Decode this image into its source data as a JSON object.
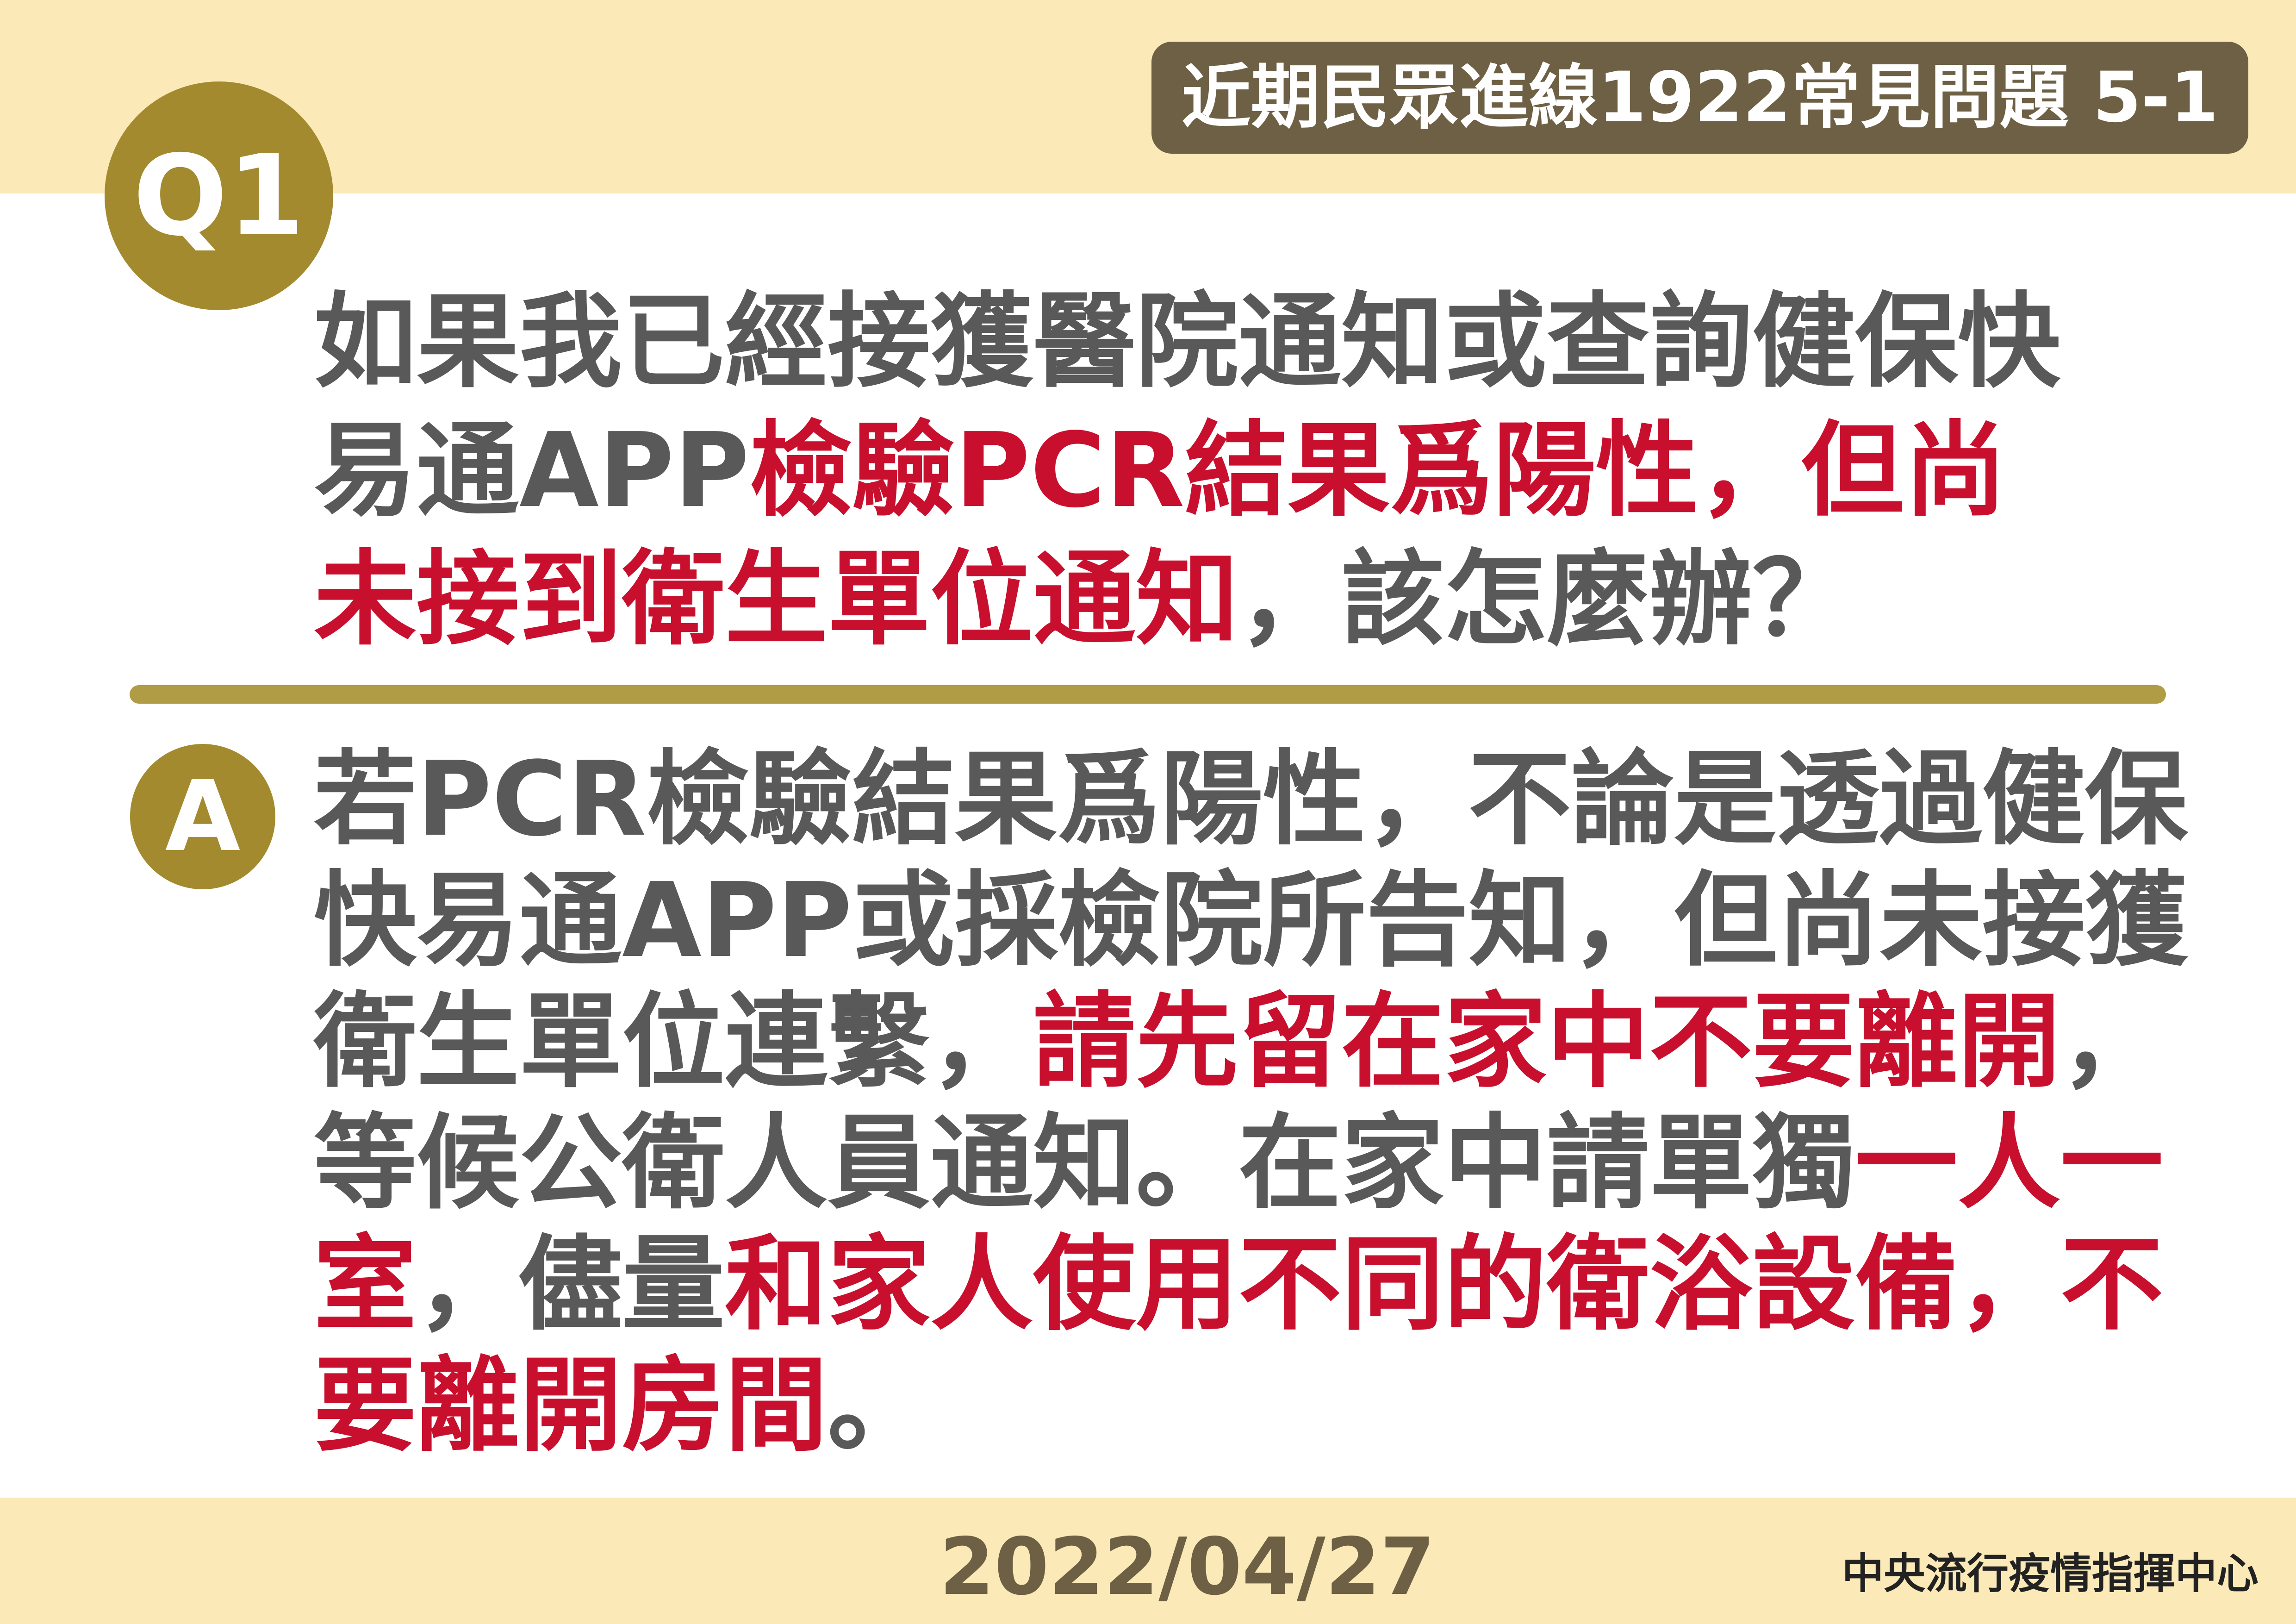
{
  "header": {
    "title": "近期民眾進線1922常見問題 5-1"
  },
  "question": {
    "badge": "Q1",
    "lines": [
      [
        {
          "text": "如果我已經接獲醫院通知或查詢健保快",
          "red": false
        }
      ],
      [
        {
          "text": "易通APP",
          "red": false
        },
        {
          "text": "檢驗PCR結果爲陽性，但尚",
          "red": true
        }
      ],
      [
        {
          "text": "未接到衛生單位通知",
          "red": true
        },
        {
          "text": "，該怎麼辦？",
          "red": false
        }
      ]
    ]
  },
  "answer": {
    "badge": "A",
    "lines": [
      [
        {
          "text": "若PCR檢驗結果爲陽性，不論是透過健保",
          "red": false
        }
      ],
      [
        {
          "text": "快易通APP或採檢院所告知，但尚未接獲",
          "red": false
        }
      ],
      [
        {
          "text": "衛生單位連繫，",
          "red": false
        },
        {
          "text": "請先留在家中不要離開",
          "red": true
        },
        {
          "text": "，",
          "red": false
        }
      ],
      [
        {
          "text": "等候公衛人員通知。在家中請單獨",
          "red": false
        },
        {
          "text": "一人一",
          "red": true
        }
      ],
      [
        {
          "text": "室",
          "red": true
        },
        {
          "text": "，儘量",
          "red": false
        },
        {
          "text": "和家人使用不同的衛浴設備，不",
          "red": true
        }
      ],
      [
        {
          "text": "要離開房間",
          "red": true
        },
        {
          "text": "。",
          "red": false
        }
      ]
    ]
  },
  "footer": {
    "date": "2022/04/27",
    "organization": "中央流行疫情指揮中心"
  },
  "colors": {
    "background_band": "#fbeab7",
    "badge_dark": "#6e6044",
    "accent_gold": "#a38a2f",
    "text_gray": "#595959",
    "highlight_red": "#c8102e"
  }
}
